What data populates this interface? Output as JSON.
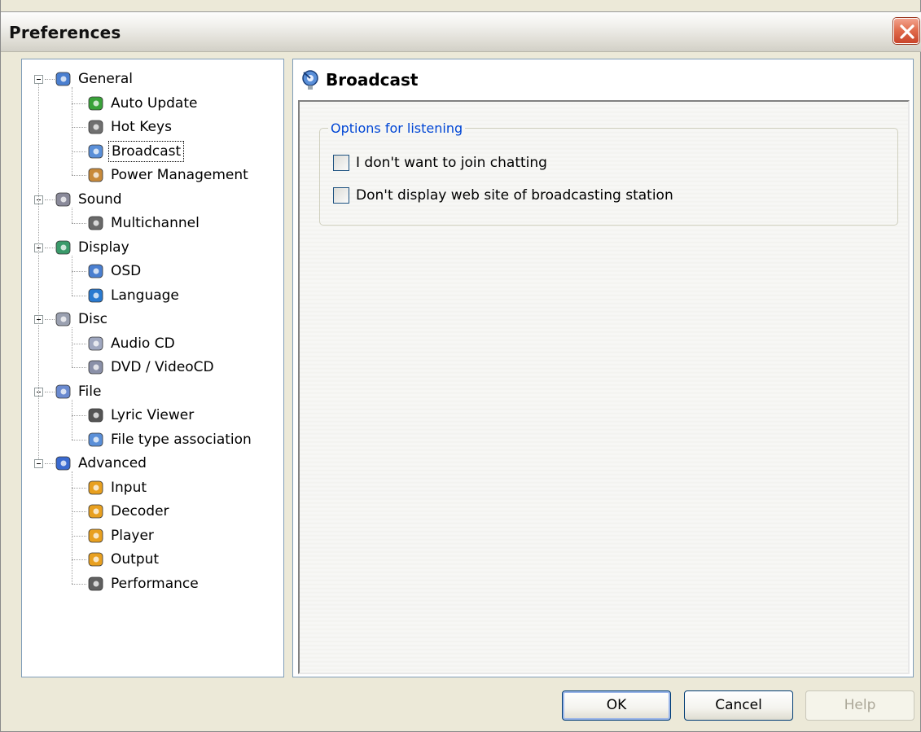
{
  "window": {
    "title": "Preferences"
  },
  "tree": {
    "items": [
      {
        "label": "General",
        "level": 0,
        "icon": "general-icon"
      },
      {
        "label": "Auto Update",
        "level": 1,
        "icon": "auto-update-icon"
      },
      {
        "label": "Hot Keys",
        "level": 1,
        "icon": "keyboard-icon"
      },
      {
        "label": "Broadcast",
        "level": 1,
        "icon": "broadcast-icon",
        "selected": true
      },
      {
        "label": "Power Management",
        "level": 1,
        "icon": "power-icon"
      },
      {
        "label": "Sound",
        "level": 0,
        "icon": "sound-icon"
      },
      {
        "label": "Multichannel",
        "level": 1,
        "icon": "multichannel-icon"
      },
      {
        "label": "Display",
        "level": 0,
        "icon": "display-icon"
      },
      {
        "label": "OSD",
        "level": 1,
        "icon": "osd-icon"
      },
      {
        "label": "Language",
        "level": 1,
        "icon": "globe-icon"
      },
      {
        "label": "Disc",
        "level": 0,
        "icon": "disc-icon"
      },
      {
        "label": "Audio CD",
        "level": 1,
        "icon": "audio-cd-icon"
      },
      {
        "label": "DVD / VideoCD",
        "level": 1,
        "icon": "dvd-icon"
      },
      {
        "label": "File",
        "level": 0,
        "icon": "file-icon"
      },
      {
        "label": "Lyric Viewer",
        "level": 1,
        "icon": "microphone-icon"
      },
      {
        "label": "File type association",
        "level": 1,
        "icon": "broadcast-icon"
      },
      {
        "label": "Advanced",
        "level": 0,
        "icon": "advanced-icon"
      },
      {
        "label": "Input",
        "level": 1,
        "icon": "cube-icon"
      },
      {
        "label": "Decoder",
        "level": 1,
        "icon": "cube-icon"
      },
      {
        "label": "Player",
        "level": 1,
        "icon": "cube-icon"
      },
      {
        "label": "Output",
        "level": 1,
        "icon": "cube-icon"
      },
      {
        "label": "Performance",
        "level": 1,
        "icon": "chip-icon"
      }
    ]
  },
  "panel": {
    "title": "Broadcast",
    "group": {
      "legend": "Options for listening",
      "options": [
        {
          "label": "I don't want to join chatting",
          "checked": false
        },
        {
          "label": "Don't display web site of broadcasting station",
          "checked": false
        }
      ]
    }
  },
  "buttons": {
    "ok": "OK",
    "cancel": "Cancel",
    "help": "Help"
  },
  "colors": {
    "accent": "#0046d5",
    "close": "#e26e4f",
    "tree_border": "#7f9db9"
  }
}
